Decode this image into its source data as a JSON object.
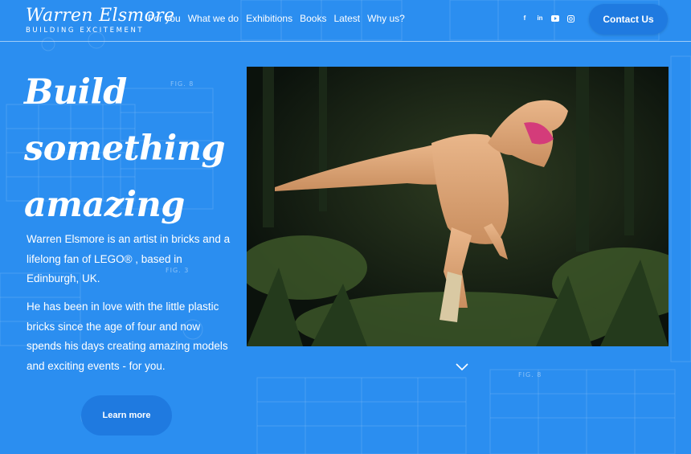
{
  "brand": {
    "name": "Warren Elsmore",
    "tagline": "BUILDING EXCITEMENT"
  },
  "nav": {
    "items": [
      {
        "label": "For you"
      },
      {
        "label": "What we do"
      },
      {
        "label": "Exhibitions"
      },
      {
        "label": "Books"
      },
      {
        "label": "Latest"
      },
      {
        "label": "Why us?"
      }
    ]
  },
  "social": {
    "icons": [
      "facebook-icon",
      "linkedin-icon",
      "youtube-icon",
      "instagram-icon"
    ]
  },
  "header": {
    "contact_label": "Contact Us"
  },
  "hero": {
    "title_line1": "Build",
    "title_line2": "something",
    "title_line3": "amazing",
    "paragraph1": "Warren Elsmore is an artist in bricks and a lifelong fan of LEGO® , based in Edinburgh, UK.",
    "paragraph2": "He has been in love with the little plastic bricks since the age of four and now spends his days creating amazing models and exciting events - for you.",
    "learn_more_label": "Learn more"
  },
  "figure_labels": {
    "fig_a": "FIG. 8",
    "fig_b": "FIG. 3",
    "fig_c": "FIG. 8"
  },
  "colors": {
    "background": "#2b8ef0",
    "button": "#1f7ae0",
    "text": "#ffffff"
  }
}
